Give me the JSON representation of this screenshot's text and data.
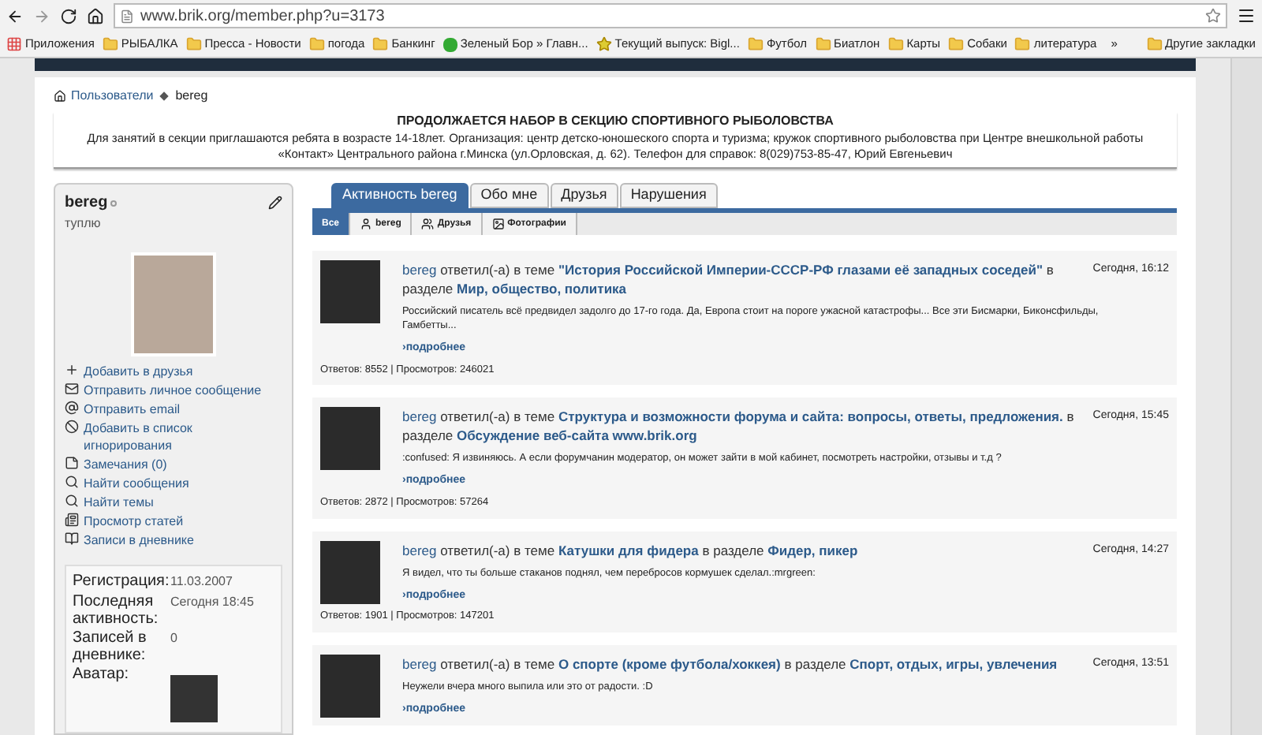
{
  "browser": {
    "url": "www.brik.org/member.php?u=3173",
    "bookmarks": [
      {
        "label": "Приложения",
        "kind": "apps"
      },
      {
        "label": "РЫБАЛКА",
        "kind": "folder"
      },
      {
        "label": "Пресса - Новости",
        "kind": "folder"
      },
      {
        "label": "погода",
        "kind": "folder"
      },
      {
        "label": "Банкинг",
        "kind": "folder"
      },
      {
        "label": "Зеленый Бор » Главн...",
        "kind": "site"
      },
      {
        "label": "Текущий выпуск: Bigl...",
        "kind": "star"
      },
      {
        "label": "Футбол",
        "kind": "folder"
      },
      {
        "label": "Биатлон",
        "kind": "folder"
      },
      {
        "label": "Карты",
        "kind": "folder"
      },
      {
        "label": "Собаки",
        "kind": "folder"
      },
      {
        "label": "литература",
        "kind": "folder"
      }
    ],
    "more": "»",
    "other_bookmarks": "Другие закладки"
  },
  "breadcrumb": [
    "Пользователи",
    "bereg"
  ],
  "notice": {
    "title": "ПРОДОЛЖАЕТСЯ НАБОР В СЕКЦИЮ СПОРТИВНОГО РЫБОЛОВСТВА",
    "text": "Для занятий в секции приглашаются ребята в возрасте 14-18лет. Организация: центр детско-юношеского спорта и туризма; кружок спортивного рыболовства при Центре внешкольной работы «Контакт» Центрального района г.Минска (ул.Орловская, д. 62). Телефон для справок: 8(029)753-85-47, Юрий Евгеньевич"
  },
  "profile": {
    "username": "bereg",
    "title": "туплю",
    "actions": [
      {
        "label": "Добавить в друзья",
        "kind": "plus"
      },
      {
        "label": "Отправить личное сообщение",
        "kind": "mail"
      },
      {
        "label": "Отправить email",
        "kind": "email"
      },
      {
        "label": "Добавить в список игнорирования",
        "kind": "block"
      },
      {
        "label": "Замечания (0)",
        "kind": "note"
      },
      {
        "label": "Найти сообщения",
        "kind": "search"
      },
      {
        "label": "Найти темы",
        "kind": "search"
      },
      {
        "label": "Просмотр статей",
        "kind": "doc"
      },
      {
        "label": "Записи в дневнике",
        "kind": "diary"
      }
    ],
    "stats": [
      {
        "label": "Регистрация:",
        "value": "11.03.2007",
        "kind": "text"
      },
      {
        "label": "Последняя активность:",
        "value": "Сегодня 18:45",
        "kind": "text"
      },
      {
        "label": "Записей в дневнике:",
        "value": "0",
        "kind": "text"
      },
      {
        "label": "Аватар:",
        "kind": "avatar"
      }
    ]
  },
  "tabs": [
    {
      "label": "Активность bereg",
      "selected": true
    },
    {
      "label": "Обо мне",
      "selected": false
    },
    {
      "label": "Друзья",
      "selected": false
    },
    {
      "label": "Нарушения",
      "selected": false
    }
  ],
  "subtabs": [
    {
      "label": "Все",
      "selected": true,
      "kind": "none"
    },
    {
      "label": "bereg",
      "selected": false,
      "kind": "user"
    },
    {
      "label": "Друзья",
      "selected": false,
      "kind": "users"
    },
    {
      "label": "Фотографии",
      "selected": false,
      "kind": "photo"
    }
  ],
  "posts": [
    {
      "header": [
        {
          "kind": "link",
          "text": "bereg"
        },
        {
          "kind": "text",
          "text": "ответил(-а) в теме"
        },
        {
          "kind": "link",
          "text": "\"История Российской Империи-СССР-РФ глазами её западных соседей\""
        },
        {
          "kind": "text",
          "text": "в разделе"
        },
        {
          "kind": "link",
          "text": "Мир, общество, политика"
        }
      ],
      "time": "Сегодня, 16:12",
      "excerpt": "Российский писатель всё предвидел задолго до 17-го года. Да, Европа стоит на пороге ужасной катастрофы... Все эти Бисмарки, Биконсфильды, Гамбетты...",
      "more": "›подробнее",
      "stats": "Ответов: 8552 | Просмотров: 246021"
    },
    {
      "header": [
        {
          "kind": "link",
          "text": "bereg"
        },
        {
          "kind": "text",
          "text": "ответил(-а) в теме"
        },
        {
          "kind": "link",
          "text": "Структура и возможности форума и сайта: вопросы, ответы, предложения."
        },
        {
          "kind": "text",
          "text": "в разделе"
        },
        {
          "kind": "link",
          "text": "Обсуждение веб-сайта www.brik.org"
        }
      ],
      "time": "Сегодня, 15:45",
      "excerpt": ":confused: Я извиняюсь. А если форумчанин модератор, он может зайти в мой кабинет, посмотреть настройки, отзывы и т.д ?",
      "more": "›подробнее",
      "stats": "Ответов: 2872 | Просмотров: 57264"
    },
    {
      "header": [
        {
          "kind": "link",
          "text": "bereg"
        },
        {
          "kind": "text",
          "text": "ответил(-а) в теме"
        },
        {
          "kind": "link",
          "text": "Катушки для фидера"
        },
        {
          "kind": "text",
          "text": "в разделе"
        },
        {
          "kind": "link",
          "text": "Фидер, пикер"
        }
      ],
      "time": "Сегодня, 14:27",
      "excerpt": "Я видел, что ты больше стаканов поднял, чем перебросов кормушек сделал.:mrgreen:",
      "more": "›подробнее",
      "stats": "Ответов: 1901 | Просмотров: 147201"
    },
    {
      "header": [
        {
          "kind": "link",
          "text": "bereg"
        },
        {
          "kind": "text",
          "text": "ответил(-а) в теме"
        },
        {
          "kind": "link",
          "text": "О спорте (кроме футбола/хоккея)"
        },
        {
          "kind": "text",
          "text": "в разделе"
        },
        {
          "kind": "link",
          "text": "Спорт, отдых, игры, увлечения"
        }
      ],
      "time": "Сегодня, 13:51",
      "excerpt": "Неужели вчера много выпила или это от радости. :D",
      "more": "›подробнее"
    }
  ]
}
